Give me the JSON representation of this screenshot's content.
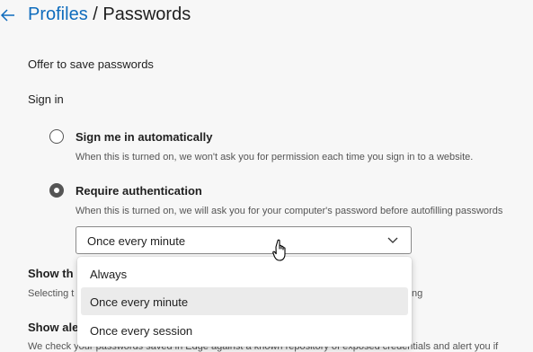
{
  "header": {
    "back_icon": "back-arrow-icon",
    "breadcrumb_link": "Profiles",
    "separator": "/",
    "title": "Passwords"
  },
  "settings": {
    "offer_label": "Offer to save passwords",
    "signin_label": "Sign in",
    "options": [
      {
        "title": "Sign me in automatically",
        "description": "When this is turned on, we won't ask you for permission each time you sign in to a website.",
        "selected": false
      },
      {
        "title": "Require authentication",
        "description": "When this is turned on, we will ask you for your computer's password before autofilling passwords",
        "selected": true
      }
    ],
    "frequency_select": {
      "value": "Once every minute",
      "options": [
        "Always",
        "Once every minute",
        "Once every session"
      ],
      "highlighted": "Once every minute"
    }
  },
  "partially_hidden": {
    "section1_title": "Show th",
    "section1_desc_start": "Selecting t",
    "section1_desc_end": "ng",
    "section2_title": "Show ale",
    "section2_desc": "We check your passwords saved in Edge against a known repository of exposed credentials and alert you if"
  },
  "colors": {
    "link": "#0f6cbd",
    "background": "#f7f7f7",
    "hover": "#ebebeb"
  }
}
